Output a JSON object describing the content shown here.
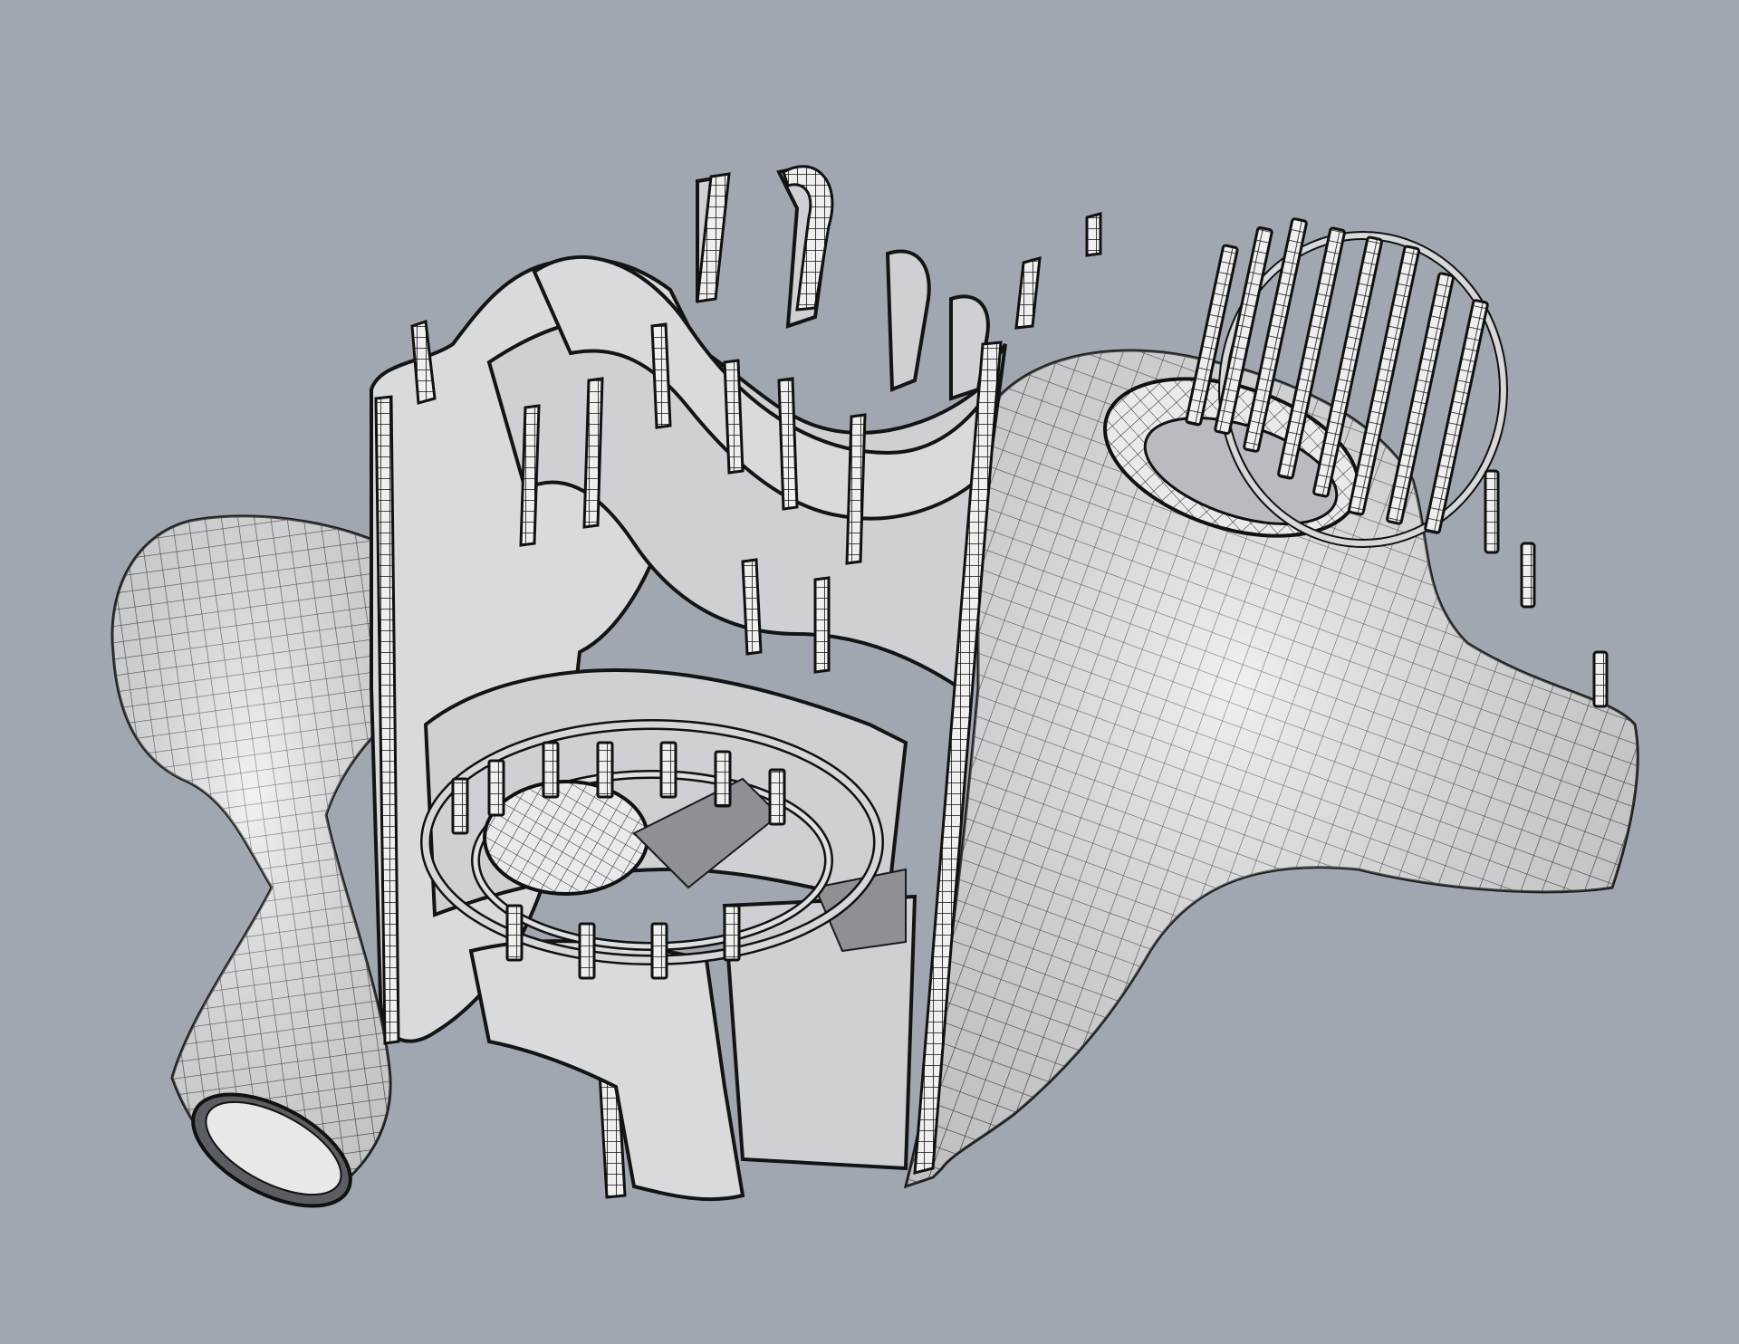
{
  "viewport": {
    "background_color": "#a1a7b0",
    "model_surface_color": "#e3e4e6",
    "wire_color": "#1b1b1b",
    "shadow_color": "#8e9096",
    "content": "wireframe-3d-model"
  },
  "icons": {
    "model": "cad-mesh-model",
    "left_arm": "mesh-tube-left",
    "right_body": "mesh-tube-right",
    "ribs": "sliced-rib-panels",
    "right_ring": "ring-frame-right",
    "center_ring": "ring-frame-center"
  }
}
